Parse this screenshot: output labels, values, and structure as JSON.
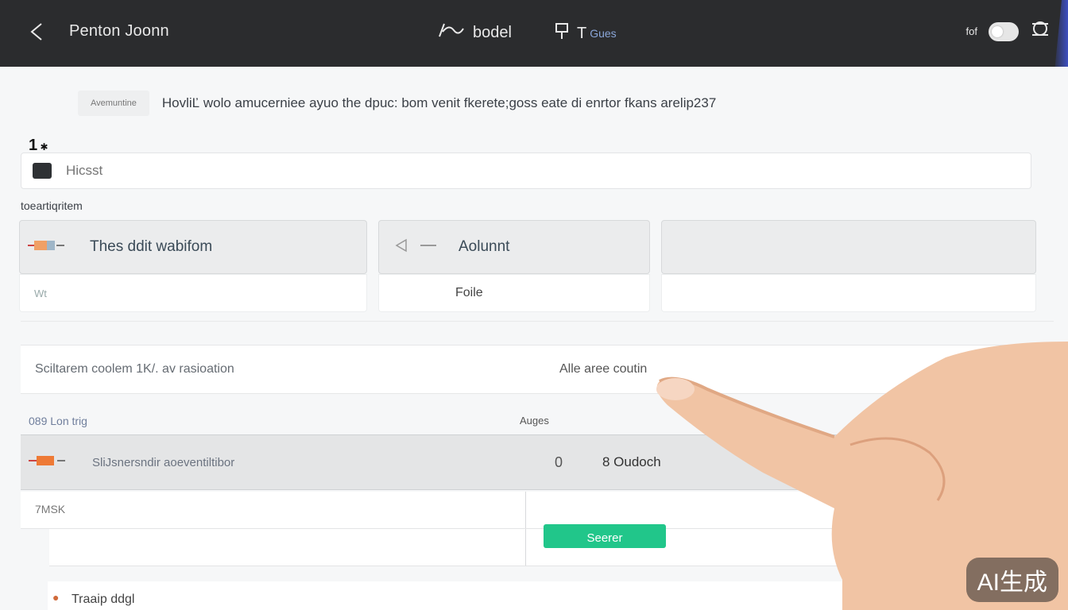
{
  "header": {
    "title": "Penton Joonn",
    "center_a": "bodel",
    "center_b": "T",
    "center_b_small": "Gues",
    "right_small": "fof"
  },
  "notice": {
    "tag": "Avemuntine",
    "message": "HovliĽ wolo amucerniee ayuo the dpuc: bom venit fkerete;goss eate di enrtor fkans arelip237"
  },
  "count_label": "1",
  "search": {
    "placeholder": "Hicsst"
  },
  "section_label": "toeartiqritem",
  "cards": [
    {
      "title": "Thes ddit wabifom",
      "sub": "Wt"
    },
    {
      "title": "Aolunnt",
      "sub": "Foile"
    },
    {
      "title": "",
      "sub": ""
    }
  ],
  "row": {
    "left": "Sciltarem coolem 1K/. av rasioation",
    "right": "Alle aree coutin"
  },
  "list": {
    "left_header": "089 Lon trig",
    "right_header": "Auges"
  },
  "highlight_row": {
    "label": "SliJsnersndir aoeventiltibor",
    "num": "0",
    "value": "8 Oudoch"
  },
  "grid_rows": [
    {
      "label": "7MSK"
    },
    {
      "label": ""
    }
  ],
  "footer": {
    "label": "Traaip ddgl",
    "button": "Seerer"
  },
  "watermark": "AI生成",
  "colors": {
    "accent": "#21c68a",
    "topbar": "#2b2c2e",
    "edge": "#3d4fc0"
  }
}
